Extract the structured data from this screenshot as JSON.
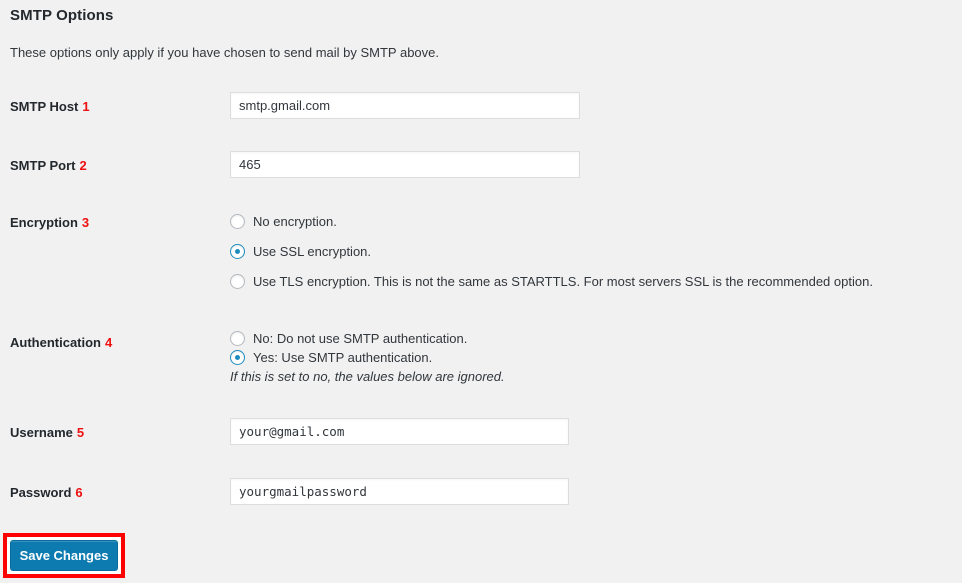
{
  "section": {
    "title": "SMTP Options",
    "description": "These options only apply if you have chosen to send mail by SMTP above."
  },
  "fields": {
    "smtp_host": {
      "label": "SMTP Host",
      "step": "1",
      "value": "smtp.gmail.com"
    },
    "smtp_port": {
      "label": "SMTP Port",
      "step": "2",
      "value": "465"
    },
    "encryption": {
      "label": "Encryption",
      "step": "3",
      "options": [
        {
          "label": "No encryption.",
          "checked": false
        },
        {
          "label": "Use SSL encryption.",
          "checked": true
        },
        {
          "label": "Use TLS encryption. This is not the same as STARTTLS. For most servers SSL is the recommended option.",
          "checked": false
        }
      ]
    },
    "authentication": {
      "label": "Authentication",
      "step": "4",
      "options": [
        {
          "label": "No: Do not use SMTP authentication.",
          "checked": false
        },
        {
          "label": "Yes: Use SMTP authentication.",
          "checked": true
        }
      ],
      "note": "If this is set to no, the values below are ignored."
    },
    "username": {
      "label": "Username",
      "step": "5",
      "value": "your@gmail.com"
    },
    "password": {
      "label": "Password",
      "step": "6",
      "value": "yourgmailpassword"
    }
  },
  "actions": {
    "save_label": "Save Changes"
  },
  "colors": {
    "page_background": "#f1f1f1",
    "accent_blue": "#0e7bb0",
    "radio_blue": "#1e8cbe",
    "annotation_red": "#ff0000",
    "step_number_red": "#ee1111",
    "input_border": "#dddddd",
    "heading_text": "#23282d"
  }
}
